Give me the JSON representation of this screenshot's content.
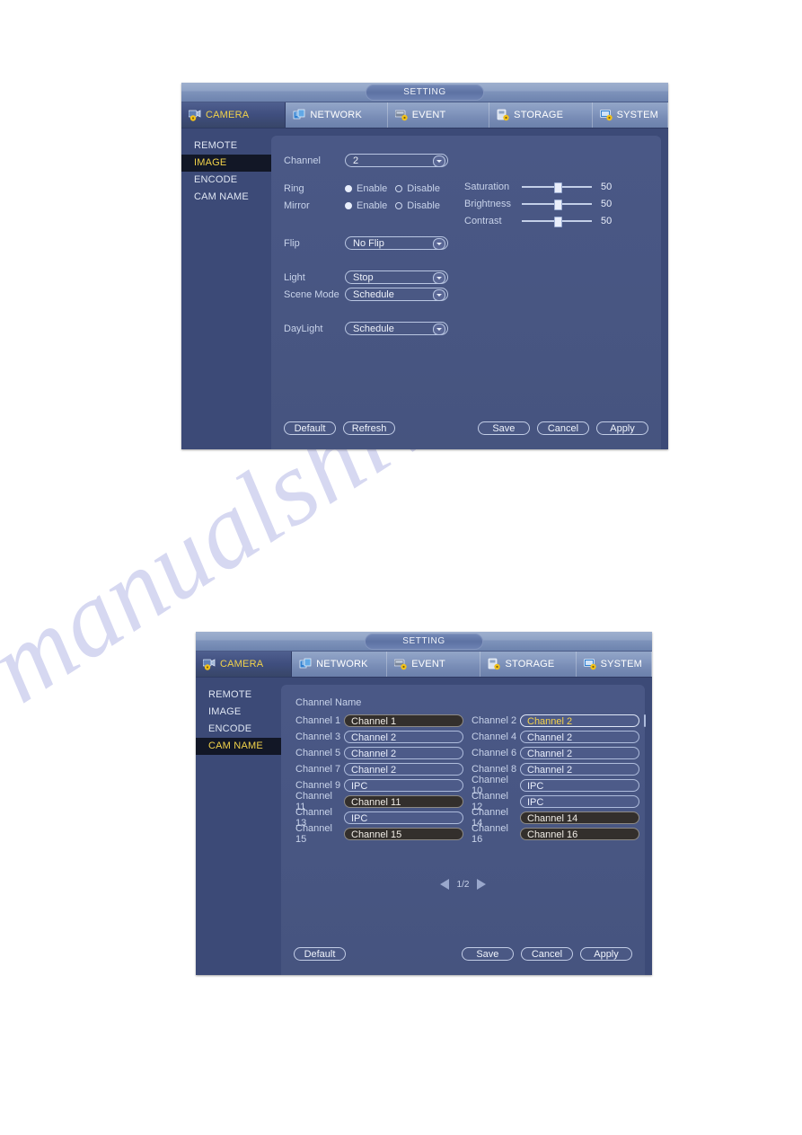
{
  "watermark": "manualshive.com",
  "window": {
    "title": "SETTING",
    "tabs": [
      {
        "label": "CAMERA",
        "icon": "camera-icon",
        "active": true
      },
      {
        "label": "NETWORK",
        "icon": "network-icon",
        "active": false
      },
      {
        "label": "EVENT",
        "icon": "event-icon",
        "active": false
      },
      {
        "label": "STORAGE",
        "icon": "storage-icon",
        "active": false
      },
      {
        "label": "SYSTEM",
        "icon": "system-icon",
        "active": false
      }
    ],
    "sidebar": [
      "REMOTE",
      "IMAGE",
      "ENCODE",
      "CAM NAME"
    ]
  },
  "image_page": {
    "active_sidebar": "IMAGE",
    "channel": {
      "label": "Channel",
      "value": "2"
    },
    "ring": {
      "label": "Ring",
      "enable_label": "Enable",
      "disable_label": "Disable",
      "value": "Enable"
    },
    "mirror": {
      "label": "Mirror",
      "enable_label": "Enable",
      "disable_label": "Disable",
      "value": "Enable"
    },
    "flip": {
      "label": "Flip",
      "value": "No Flip"
    },
    "light": {
      "label": "Light",
      "value": "Stop"
    },
    "scene_mode": {
      "label": "Scene Mode",
      "value": "Schedule"
    },
    "daylight": {
      "label": "DayLight",
      "value": "Schedule"
    },
    "sliders": [
      {
        "label": "Saturation",
        "value": 50,
        "min": 0,
        "max": 100
      },
      {
        "label": "Brightness",
        "value": 50,
        "min": 0,
        "max": 100
      },
      {
        "label": "Contrast",
        "value": 50,
        "min": 0,
        "max": 100
      }
    ],
    "buttons": {
      "default": "Default",
      "refresh": "Refresh",
      "save": "Save",
      "cancel": "Cancel",
      "apply": "Apply"
    }
  },
  "camname_page": {
    "active_sidebar": "CAM NAME",
    "section_title": "Channel Name",
    "rows": [
      {
        "left_label": "Channel 1",
        "left_value": "Channel 1",
        "left_style": "dark",
        "right_label": "Channel 2",
        "right_value": "Channel 2",
        "right_style": "focus",
        "has_keyboard": true
      },
      {
        "left_label": "Channel 3",
        "left_value": "Channel 2",
        "left_style": "normal",
        "right_label": "Channel 4",
        "right_value": "Channel 2",
        "right_style": "normal",
        "has_keyboard": false
      },
      {
        "left_label": "Channel 5",
        "left_value": "Channel 2",
        "left_style": "normal",
        "right_label": "Channel 6",
        "right_value": "Channel 2",
        "right_style": "normal",
        "has_keyboard": false
      },
      {
        "left_label": "Channel 7",
        "left_value": "Channel 2",
        "left_style": "normal",
        "right_label": "Channel 8",
        "right_value": "Channel 2",
        "right_style": "normal",
        "has_keyboard": false
      },
      {
        "left_label": "Channel 9",
        "left_value": "IPC",
        "left_style": "normal",
        "right_label": "Channel 10",
        "right_value": "IPC",
        "right_style": "normal",
        "has_keyboard": false
      },
      {
        "left_label": "Channel 11",
        "left_value": "Channel 11",
        "left_style": "dark",
        "right_label": "Channel 12",
        "right_value": "IPC",
        "right_style": "normal",
        "has_keyboard": false
      },
      {
        "left_label": "Channel 13",
        "left_value": "IPC",
        "left_style": "normal",
        "right_label": "Channel 14",
        "right_value": "Channel 14",
        "right_style": "dark",
        "has_keyboard": false
      },
      {
        "left_label": "Channel 15",
        "left_value": "Channel 15",
        "left_style": "dark",
        "right_label": "Channel 16",
        "right_value": "Channel 16",
        "right_style": "dark",
        "has_keyboard": false
      }
    ],
    "pager": {
      "text": "1/2",
      "prev_icon": "triangle-left-icon",
      "next_icon": "triangle-right-icon"
    },
    "buttons": {
      "default": "Default",
      "save": "Save",
      "cancel": "Cancel",
      "apply": "Apply"
    }
  },
  "colors": {
    "dialog_bg": "#3c4a77",
    "content_bg": "#4a5886",
    "accent_yellow": "#f2d34a",
    "label_text": "#c8d3ea",
    "active_sidebar_bg": "#121726"
  }
}
